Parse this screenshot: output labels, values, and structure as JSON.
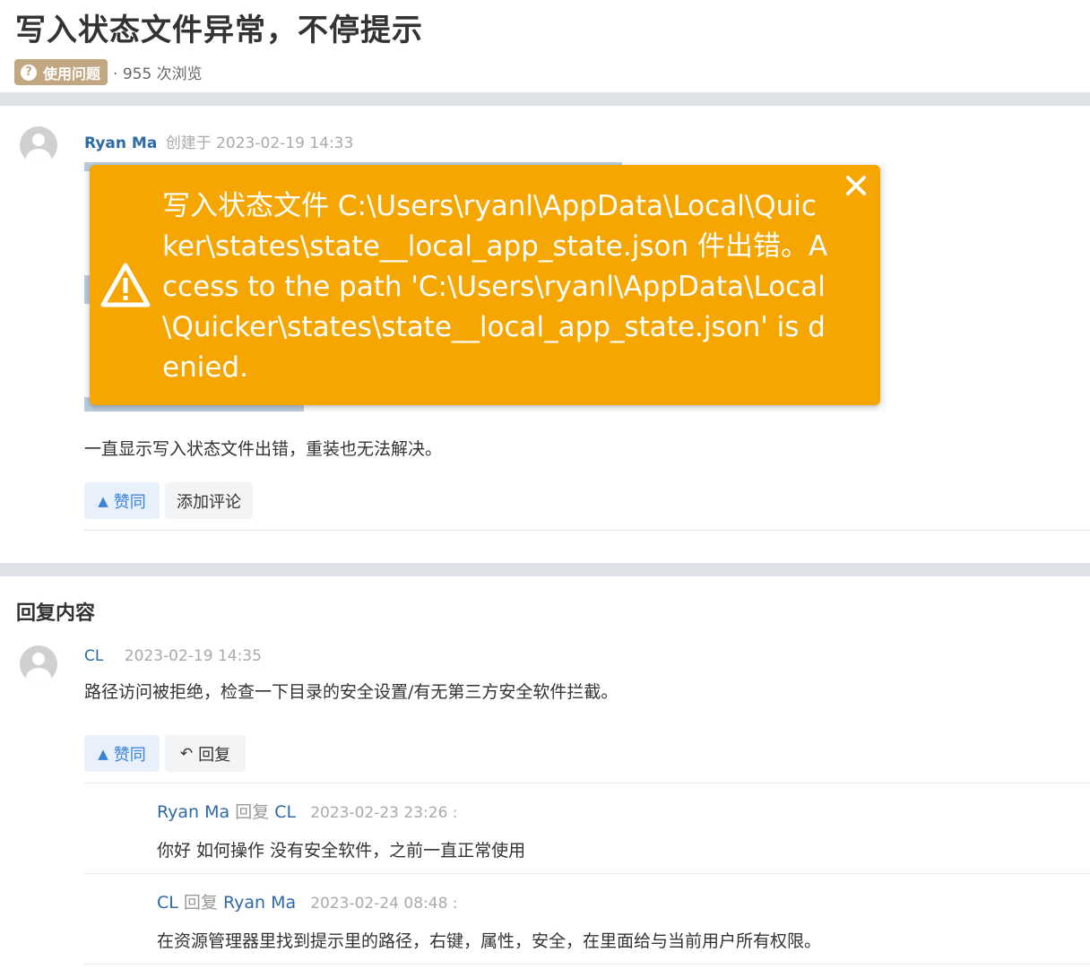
{
  "page": {
    "title": "写入状态文件异常，不停提示",
    "tag": "使用问题",
    "views": "· 955 次浏览"
  },
  "post": {
    "author": "Ryan Ma",
    "created": "创建于 2023-02-19 14:33",
    "error_message": "写入状态文件 C:\\Users\\ryanl\\AppData\\Local\\Quicker\\states\\state__local_app_state.json 件出错。Access to the path 'C:\\Users\\ryanl\\AppData\\Local\\Quicker\\states\\state__local_app_state.json' is denied.",
    "body": "一直显示写入状态文件出错，重装也无法解决。",
    "like_label": "赞同",
    "comment_label": "添加评论"
  },
  "replies_section": {
    "title": "回复内容",
    "reply": {
      "author": "CL",
      "time": "2023-02-19 14:35",
      "body": "路径访问被拒绝，检查一下目录的安全设置/有无第三方安全软件拦截。",
      "like_label": "赞同",
      "reply_label": "回复"
    },
    "sub_replies": [
      {
        "from": "Ryan Ma",
        "verb": "回复",
        "to": "CL",
        "time": "2023-02-23 23:26 :",
        "body": "你好 如何操作 没有安全软件，之前一直正常使用"
      },
      {
        "from": "CL",
        "verb": "回复",
        "to": "Ryan Ma",
        "time": "2023-02-24 08:48 :",
        "body": "在资源管理器里找到提示里的路径，右键，属性，安全，在里面给与当前用户所有权限。"
      }
    ]
  },
  "colors": {
    "toast": "#f5a600",
    "link": "#2e6aa6",
    "tag": "#c2a882",
    "like": "#3a82d6"
  }
}
